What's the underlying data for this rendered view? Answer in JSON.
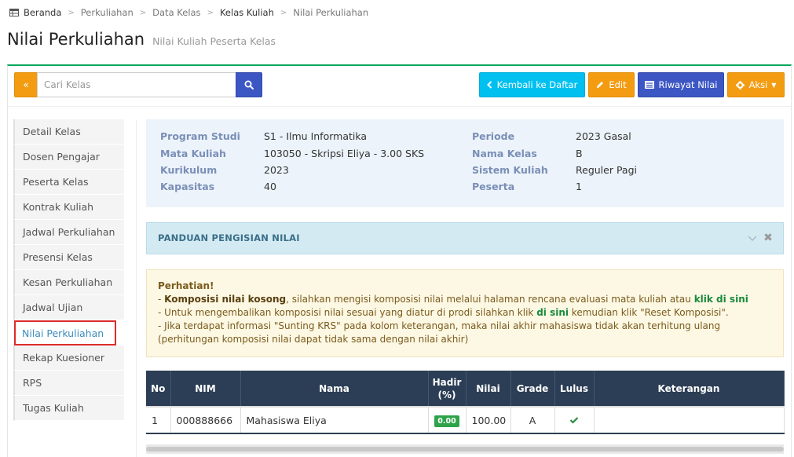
{
  "breadcrumb": {
    "items": [
      "Beranda",
      "Perkuliahan",
      "Data Kelas",
      "Kelas Kuliah",
      "Nilai Perkuliahan"
    ]
  },
  "header": {
    "title": "Nilai Perkuliahan",
    "subtitle": "Nilai Kuliah Peserta Kelas"
  },
  "toolbar": {
    "search_placeholder": "Cari Kelas",
    "search_value": "",
    "back_label": "Kembali ke Daftar",
    "edit_label": "Edit",
    "history_label": "Riwayat Nilai",
    "action_label": "Aksi"
  },
  "sidebar": {
    "items": [
      {
        "label": "Detail Kelas",
        "active": false
      },
      {
        "label": "Dosen Pengajar",
        "active": false
      },
      {
        "label": "Peserta Kelas",
        "active": false
      },
      {
        "label": "Kontrak Kuliah",
        "active": false
      },
      {
        "label": "Jadwal Perkuliahan",
        "active": false
      },
      {
        "label": "Presensi Kelas",
        "active": false
      },
      {
        "label": "Kesan Perkuliahan",
        "active": false
      },
      {
        "label": "Jadwal Ujian",
        "active": false
      },
      {
        "label": "Nilai Perkuliahan",
        "active": true
      },
      {
        "label": "Rekap Kuesioner",
        "active": false
      },
      {
        "label": "RPS",
        "active": false
      },
      {
        "label": "Tugas Kuliah",
        "active": false
      }
    ]
  },
  "info": {
    "program_studi_label": "Program Studi",
    "program_studi": "S1 - Ilmu Informatika",
    "mata_kuliah_label": "Mata Kuliah",
    "mata_kuliah": "103050 - Skripsi Eliya - 3.00 SKS",
    "kurikulum_label": "Kurikulum",
    "kurikulum": "2023",
    "kapasitas_label": "Kapasitas",
    "kapasitas": "40",
    "periode_label": "Periode",
    "periode": "2023 Gasal",
    "nama_kelas_label": "Nama Kelas",
    "nama_kelas": "B",
    "sistem_kuliah_label": "Sistem Kuliah",
    "sistem_kuliah": "Reguler Pagi",
    "peserta_label": "Peserta",
    "peserta": "1"
  },
  "guide": {
    "title": "PANDUAN PENGISIAN NILAI"
  },
  "alert": {
    "title": "Perhatian!",
    "line1_prefix": "- ",
    "line1_strong": "Komposisi nilai kosong",
    "line1_text": ", silahkan mengisi komposisi nilai melalui halaman rencana evaluasi mata kuliah atau ",
    "line1_link": "klik di sini",
    "line2_text": "- Untuk mengembalikan komposisi nilai sesuai yang diatur di prodi silahkan klik ",
    "line2_link": "di sini",
    "line2_suffix": " kemudian klik \"Reset Komposisi\".",
    "line3_text": "- Jika terdapat informasi \"Sunting KRS\" pada kolom keterangan, maka nilai akhir mahasiswa tidak akan terhitung ulang (perhitungan komposisi nilai dapat tidak sama dengan nilai akhir)"
  },
  "table": {
    "headers": {
      "no": "No",
      "nim": "NIM",
      "nama": "Nama",
      "hadir_1": "Hadir",
      "hadir_2": "(%)",
      "nilai": "Nilai",
      "grade": "Grade",
      "lulus": "Lulus",
      "keterangan": "Keterangan"
    },
    "rows": [
      {
        "no": "1",
        "nim": "000888666",
        "nama": "Mahasiswa Eliya",
        "hadir": "0.00",
        "nilai": "100.00",
        "grade": "A",
        "lulus": "check-icon",
        "keterangan": ""
      }
    ]
  },
  "colors": {
    "accent_green": "#00a65a",
    "orange": "#f39c12",
    "cyan": "#00c0ef",
    "indigo": "#3c56c4",
    "table_header": "#2c3e55",
    "active_border": "#dd2b2b"
  }
}
